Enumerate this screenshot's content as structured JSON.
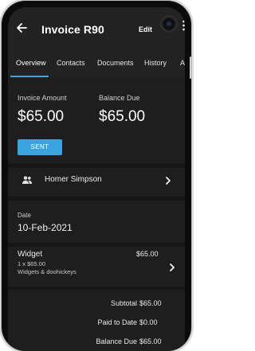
{
  "header": {
    "title": "Invoice R90",
    "edit_label": "Edit"
  },
  "tabs": [
    {
      "label": "Overview"
    },
    {
      "label": "Contacts"
    },
    {
      "label": "Documents"
    },
    {
      "label": "History"
    },
    {
      "label": "Ac"
    }
  ],
  "summary": {
    "invoice_amount_label": "Invoice Amount",
    "invoice_amount_value": "$65.00",
    "balance_due_label": "Balance Due",
    "balance_due_value": "$65.00",
    "status_label": "SENT"
  },
  "client": {
    "name": "Homer Simpson"
  },
  "date": {
    "label": "Date",
    "value": "10-Feb-2021"
  },
  "line_item": {
    "name": "Widget",
    "quantity_price": "1 x $65.00",
    "description": "Widgets & doohickeys",
    "amount": "$65.00"
  },
  "totals": {
    "subtotal_label": "Subtotal",
    "subtotal_value": "$65.00",
    "paid_label": "Paid to Date",
    "paid_value": "$0.00",
    "balance_label": "Balance Due",
    "balance_value": "$65.00"
  },
  "colors": {
    "accent": "#3ba4e0",
    "background": "#1e1e1e",
    "appbar": "#222222"
  }
}
